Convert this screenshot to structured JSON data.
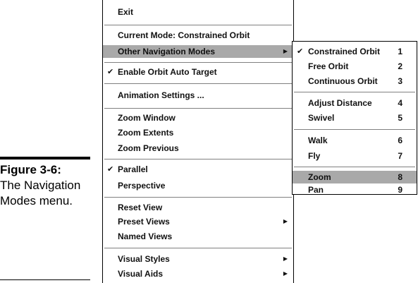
{
  "caption": {
    "figure_label": "Figure 3-6:",
    "text": "The Navigation Modes menu."
  },
  "main_menu": {
    "exit": "Exit",
    "current_mode": "Current Mode: Constrained Orbit",
    "other_navigation_modes": "Other Navigation Modes",
    "enable_orbit_auto_target": "Enable Orbit Auto Target",
    "animation_settings": "Animation Settings ...",
    "zoom_window": "Zoom Window",
    "zoom_extents": "Zoom Extents",
    "zoom_previous": "Zoom Previous",
    "parallel": "Parallel",
    "perspective": "Perspective",
    "reset_view": "Reset View",
    "preset_views": "Preset Views",
    "named_views": "Named Views",
    "visual_styles": "Visual Styles",
    "visual_aids": "Visual Aids"
  },
  "submenu": {
    "items": [
      {
        "label": "Constrained Orbit",
        "shortcut": "1"
      },
      {
        "label": "Free Orbit",
        "shortcut": "2"
      },
      {
        "label": "Continuous Orbit",
        "shortcut": "3"
      },
      {
        "label": "Adjust Distance",
        "shortcut": "4"
      },
      {
        "label": "Swivel",
        "shortcut": "5"
      },
      {
        "label": "Walk",
        "shortcut": "6"
      },
      {
        "label": "Fly",
        "shortcut": "7"
      },
      {
        "label": "Zoom",
        "shortcut": "8"
      },
      {
        "label": "Pan",
        "shortcut": "9"
      }
    ]
  },
  "colors": {
    "highlight": "#a9a9a9",
    "separator": "#808080"
  },
  "icons": {
    "check": "✔",
    "submenu_arrow": "▶"
  }
}
